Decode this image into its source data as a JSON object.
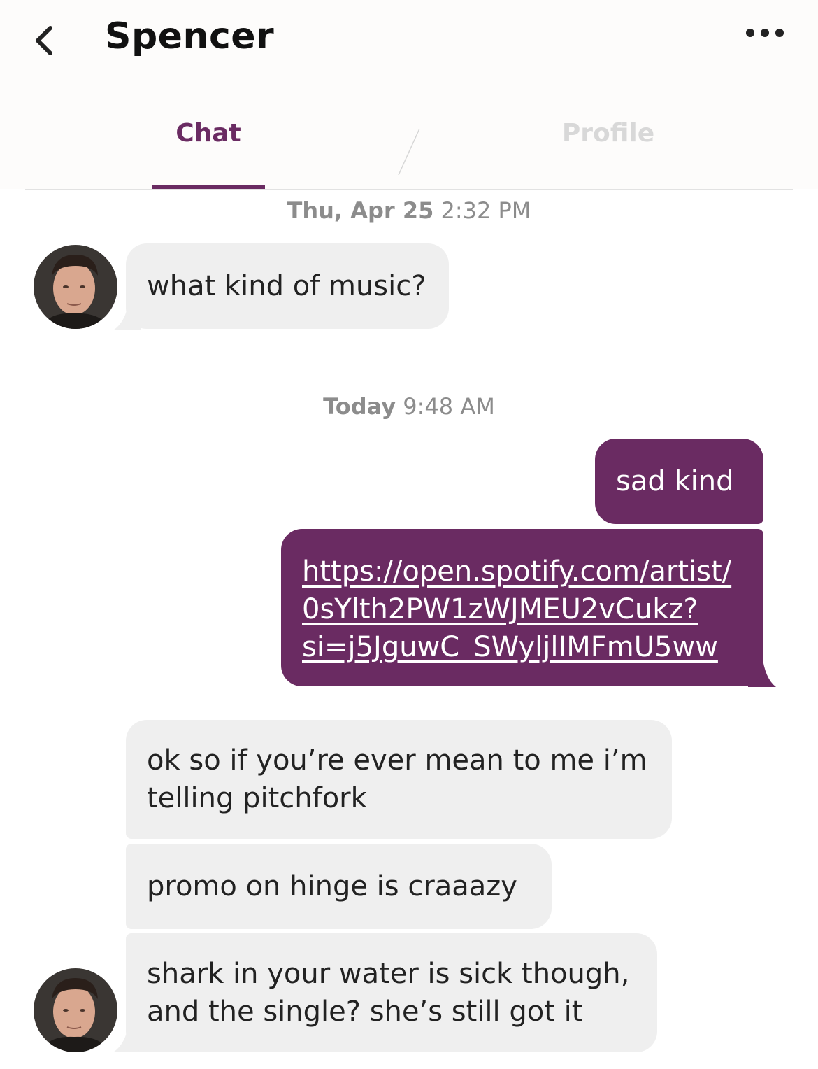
{
  "header": {
    "contact_name": "Spencer",
    "back_icon": "chevron-left-icon",
    "more_icon": "more-horizontal-icon"
  },
  "tabs": [
    {
      "label": "Chat",
      "active": true
    },
    {
      "label": "Profile",
      "active": false
    }
  ],
  "colors": {
    "accent": "#6a2b62",
    "incoming_bubble": "#efefef",
    "timestamp": "#8c8c8c",
    "inactive_tab": "#d8d8d8"
  },
  "messages": {
    "stamp1": {
      "day": "Thu, Apr 25",
      "time": "2:32 PM"
    },
    "m1": "what kind of music?",
    "stamp2": {
      "day": "Today",
      "time": "9:48 AM"
    },
    "m2": "sad kind",
    "m3_line1": "https://open.spotify.com/artist/",
    "m3_line2": "0sYlth2PW1zWJMEU2vCukz?",
    "m3_line3": "si=j5JguwC_SWyljlIMFmU5ww",
    "m4": "ok so if you’re ever mean to me i’m telling pitchfork",
    "m5": "promo on hinge is craaazy",
    "m6": "shark in your water is sick though, and the single? she’s still got it"
  }
}
